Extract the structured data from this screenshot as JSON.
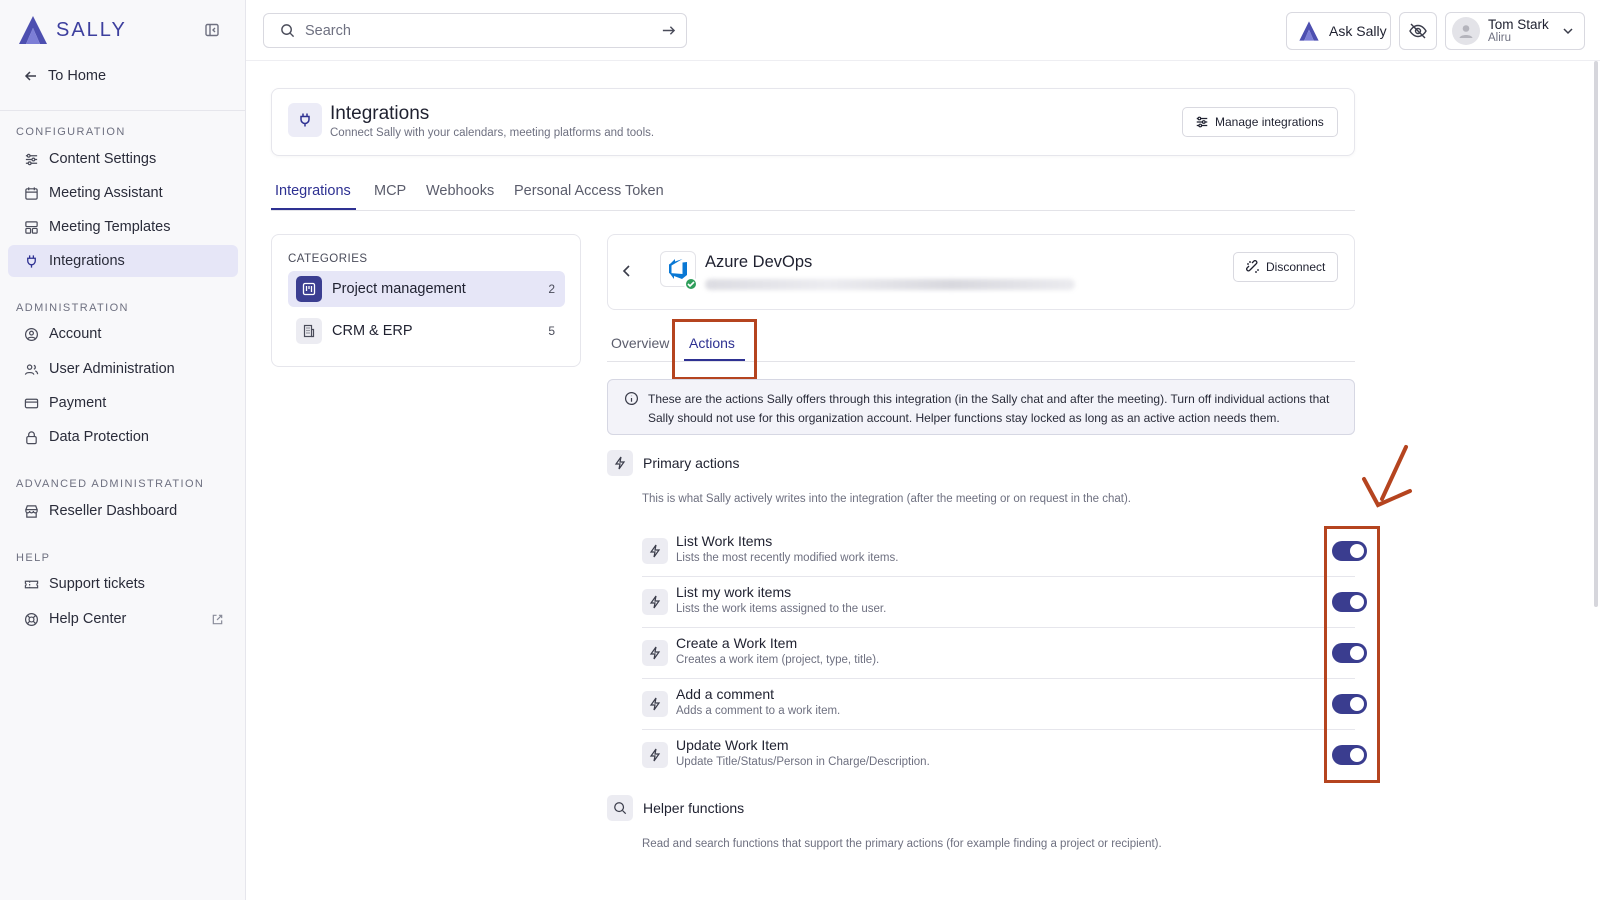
{
  "app": {
    "brand": "SALLY"
  },
  "sidebar": {
    "to_home": "To Home",
    "sections": [
      {
        "label": "CONFIGURATION",
        "items": [
          "Content Settings",
          "Meeting Assistant",
          "Meeting Templates",
          "Integrations"
        ]
      },
      {
        "label": "ADMINISTRATION",
        "items": [
          "Account",
          "User Administration",
          "Payment",
          "Data Protection"
        ]
      },
      {
        "label": "ADVANCED ADMINISTRATION",
        "items": [
          "Reseller Dashboard"
        ]
      },
      {
        "label": "HELP",
        "items": [
          "Support tickets",
          "Help Center"
        ]
      }
    ],
    "active_item": "Integrations"
  },
  "topbar": {
    "search_placeholder": "Search",
    "ask_label": "Ask Sally",
    "user": {
      "name": "Tom Stark",
      "org": "Aliru"
    }
  },
  "header": {
    "title": "Integrations",
    "subtitle": "Connect Sally with your calendars, meeting platforms and tools.",
    "manage_label": "Manage integrations"
  },
  "tabs": [
    "Integrations",
    "MCP",
    "Webhooks",
    "Personal Access Token"
  ],
  "active_tab": "Integrations",
  "categories": {
    "label": "CATEGORIES",
    "items": [
      {
        "name": "Project management",
        "count": "2"
      },
      {
        "name": "CRM & ERP",
        "count": "5"
      }
    ],
    "active": "Project management"
  },
  "integration": {
    "name": "Azure DevOps",
    "connected": true,
    "disconnect_label": "Disconnect",
    "subtabs": [
      "Overview",
      "Actions"
    ],
    "active_subtab": "Actions"
  },
  "info": {
    "text": "These are the actions Sally offers through this integration (in the Sally chat and after the meeting). Turn off individual actions that Sally should not use for this organization account. Helper functions stay locked as long as an active action needs them."
  },
  "primary": {
    "title": "Primary actions",
    "description": "This is what Sally actively writes into the integration (after the meeting or on request in the chat).",
    "actions": [
      {
        "title": "List Work Items",
        "desc": "Lists the most recently modified work items.",
        "enabled": true
      },
      {
        "title": "List my work items",
        "desc": "Lists the work items assigned to the user.",
        "enabled": true
      },
      {
        "title": "Create a Work Item",
        "desc": "Creates a work item (project, type, title).",
        "enabled": true
      },
      {
        "title": "Add a comment",
        "desc": "Adds a comment to a work item.",
        "enabled": true
      },
      {
        "title": "Update Work Item",
        "desc": "Update Title/Status/Person in Charge/Description.",
        "enabled": true
      }
    ]
  },
  "helper": {
    "title": "Helper functions",
    "description": "Read and search functions that support the primary actions (for example finding a project or recipient)."
  },
  "colors": {
    "accent": "#2e3192",
    "toggle_on": "#3a3d8f",
    "annotation": "#b5441f",
    "success": "#2f9e5b"
  }
}
